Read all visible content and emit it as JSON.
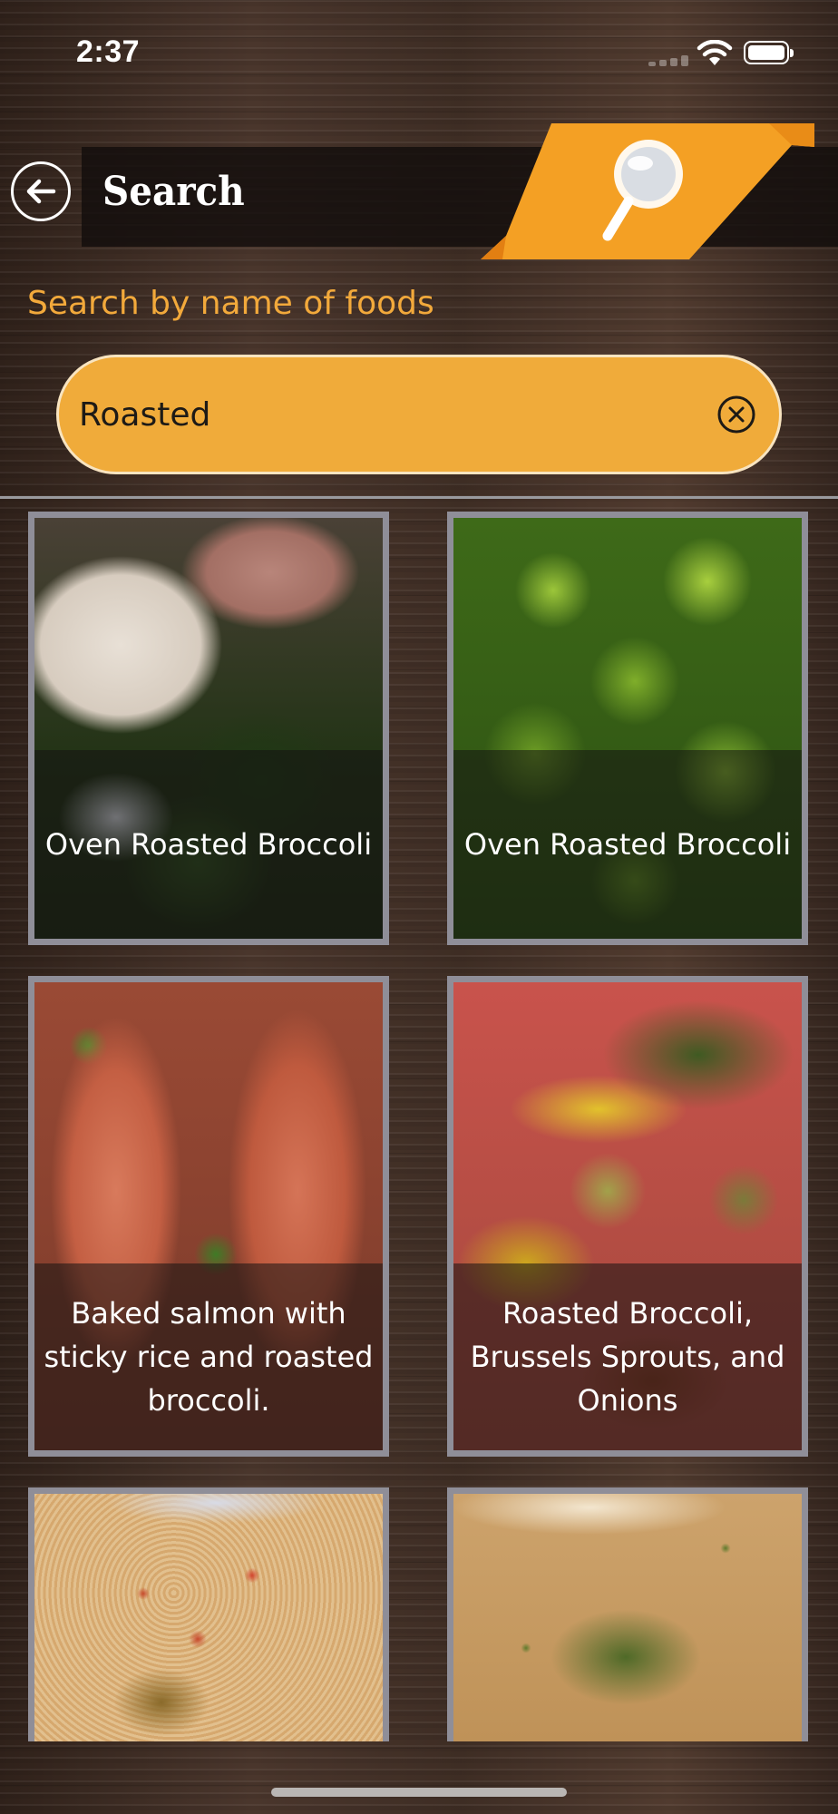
{
  "status_bar": {
    "time": "2:37"
  },
  "header": {
    "title": "Search"
  },
  "search": {
    "label": "Search by name of foods",
    "value": "Roasted",
    "placeholder": ""
  },
  "results": [
    {
      "title": "Oven Roasted Broccoli"
    },
    {
      "title": "Oven Roasted Broccoli"
    },
    {
      "title": "Baked salmon with sticky rice and roasted broccoli."
    },
    {
      "title": "Roasted Broccoli, Brussels Sprouts, and Onions"
    },
    {
      "title": ""
    },
    {
      "title": ""
    }
  ],
  "icons": {
    "back": "back-arrow-icon",
    "search": "magnifier-icon",
    "clear": "clear-circle-x-icon"
  },
  "colors": {
    "accent": "#f0ab3a",
    "label": "#f2a93b",
    "card_border": "#8f8e98"
  }
}
